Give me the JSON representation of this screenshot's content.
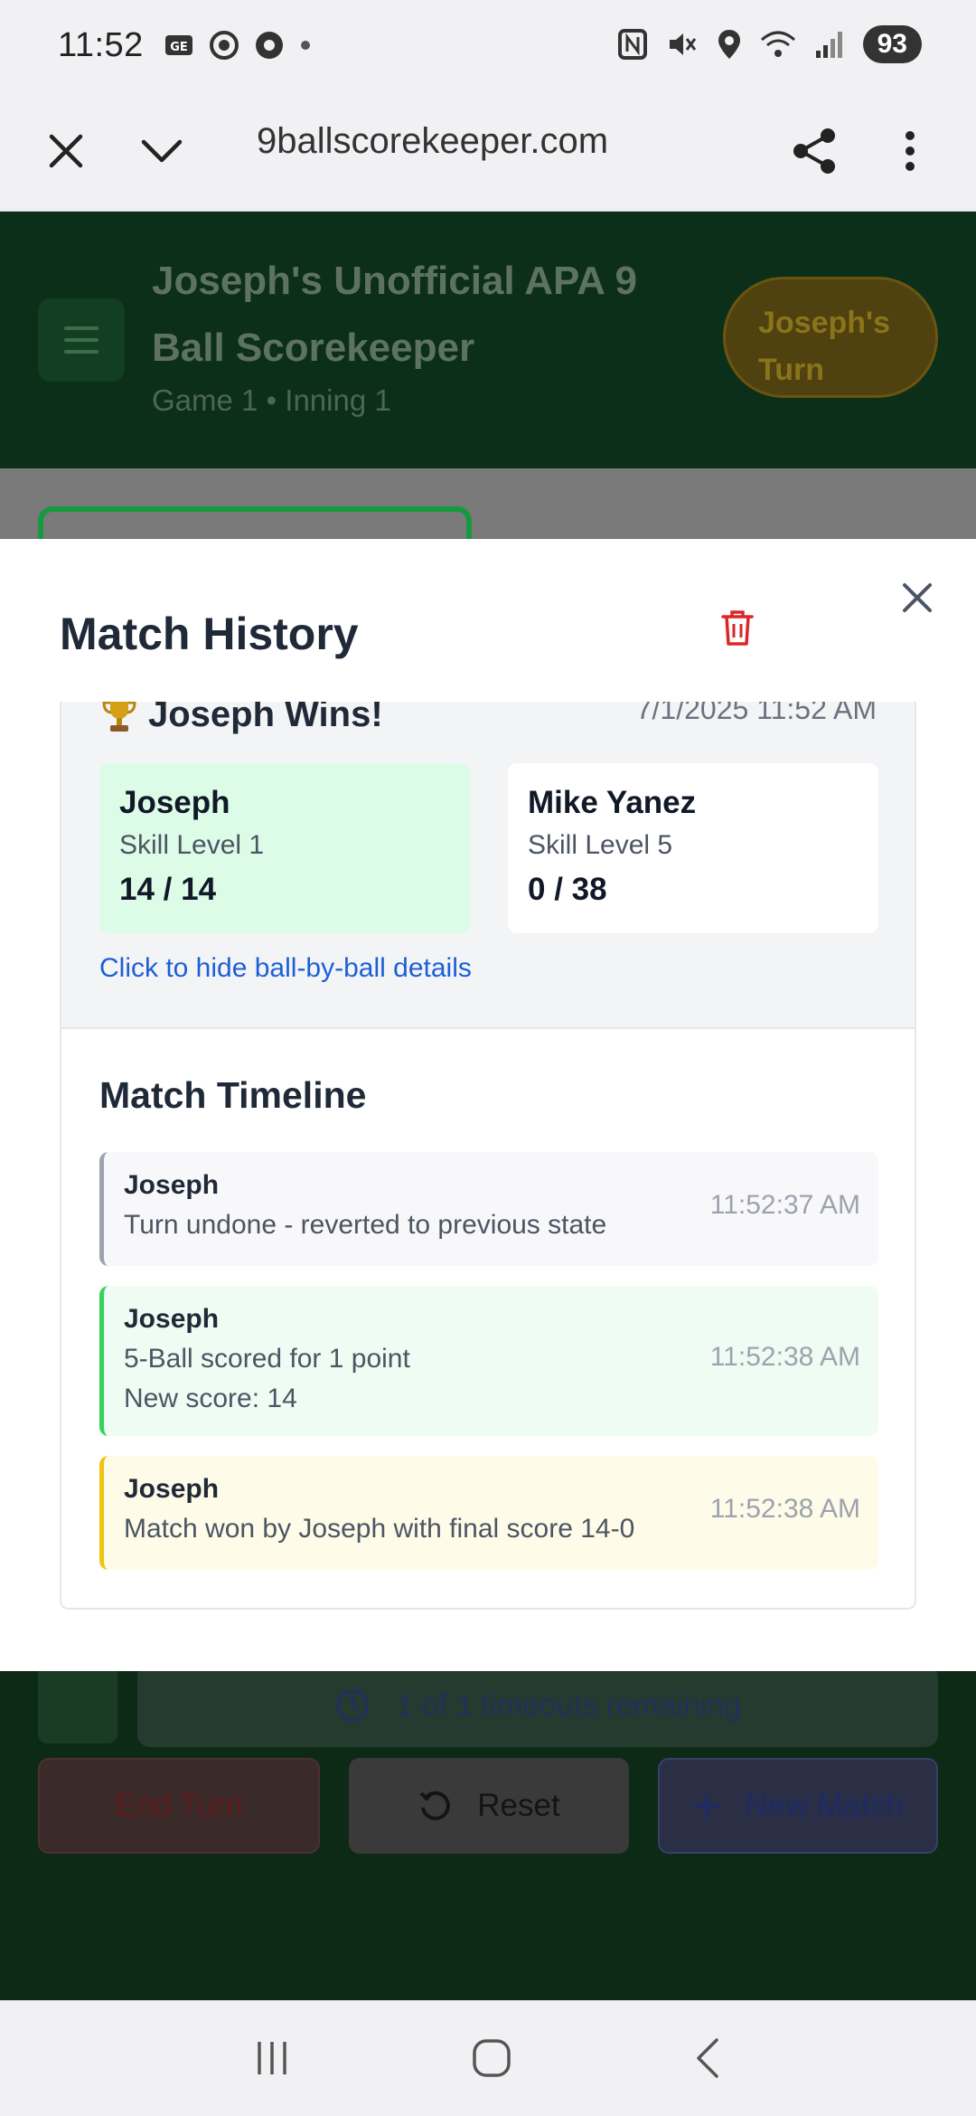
{
  "status_bar": {
    "time": "11:52",
    "battery": "93"
  },
  "browser": {
    "url": "9ballscorekeeper.com"
  },
  "app": {
    "title": "Joseph's Unofficial APA 9 Ball Scorekeeper",
    "subtitle": "Game 1 • Inning 1",
    "turn_badge": "Joseph's Turn",
    "timeouts": "1 of 1 timeouts remaining",
    "end_turn": "End Turn",
    "reset": "Reset",
    "new_match": "New Match"
  },
  "modal": {
    "title": "Match History",
    "record": {
      "winner": "Joseph Wins!",
      "date": "7/1/2025 11:52 AM",
      "players": [
        {
          "name": "Joseph",
          "skill": "Skill Level 1",
          "score": "14 / 14"
        },
        {
          "name": "Mike Yanez",
          "skill": "Skill Level 5",
          "score": "0 / 38"
        }
      ],
      "toggle_details": "Click to hide ball-by-ball details"
    },
    "timeline": {
      "title": "Match Timeline",
      "events": [
        {
          "player": "Joseph",
          "text": "Turn undone - reverted to previous state",
          "time": "11:52:37 AM"
        },
        {
          "player": "Joseph",
          "text": "5-Ball scored for 1 point",
          "sub": "New score: 14",
          "time": "11:52:38 AM"
        },
        {
          "player": "Joseph",
          "text": "Match won by Joseph with final score 14-0",
          "time": "11:52:38 AM"
        }
      ]
    }
  }
}
